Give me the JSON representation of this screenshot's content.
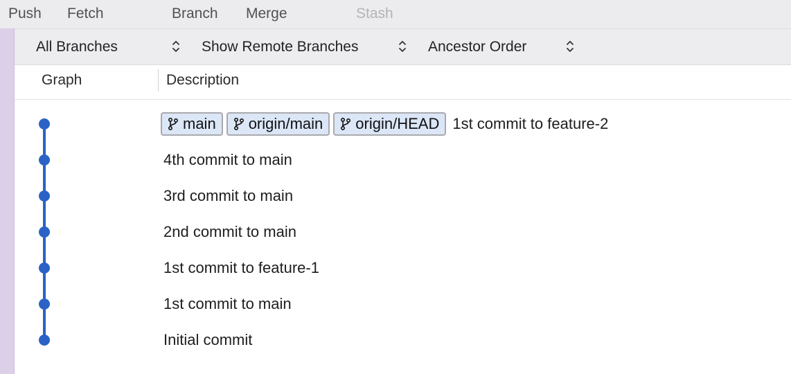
{
  "toolbar": {
    "push": "Push",
    "fetch": "Fetch",
    "branch": "Branch",
    "merge": "Merge",
    "stash": "Stash"
  },
  "filters": {
    "branches": "All Branches",
    "remote": "Show Remote Branches",
    "order": "Ancestor Order"
  },
  "columns": {
    "graph": "Graph",
    "description": "Description"
  },
  "commits": [
    {
      "refs": [
        "main",
        "origin/main",
        "origin/HEAD"
      ],
      "message": "1st commit to feature-2"
    },
    {
      "refs": [],
      "message": "4th commit to main"
    },
    {
      "refs": [],
      "message": "3rd commit to main"
    },
    {
      "refs": [],
      "message": "2nd commit to main"
    },
    {
      "refs": [],
      "message": "1st commit to feature-1"
    },
    {
      "refs": [],
      "message": "1st commit to main"
    },
    {
      "refs": [],
      "message": "Initial commit"
    }
  ],
  "colors": {
    "graph": "#2a62c6",
    "badge_bg": "#dbe6f6",
    "sidebar_stripe": "#dccfe8"
  }
}
